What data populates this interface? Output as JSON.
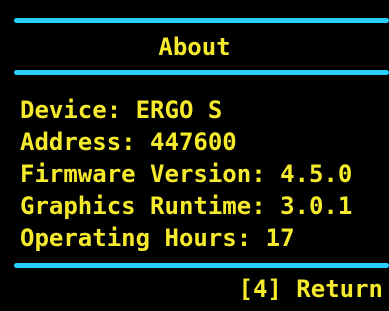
{
  "header": {
    "title": "About"
  },
  "info": {
    "lines": [
      "Device: ERGO S",
      "Address: 447600",
      "Firmware Version: 4.5.0",
      "Graphics Runtime: 3.0.1",
      "Operating Hours: 17"
    ]
  },
  "footer": {
    "return_label": "[4] Return"
  },
  "colors": {
    "background": "#000000",
    "text": "#f6ea2c",
    "rule": "#29d0ff"
  }
}
